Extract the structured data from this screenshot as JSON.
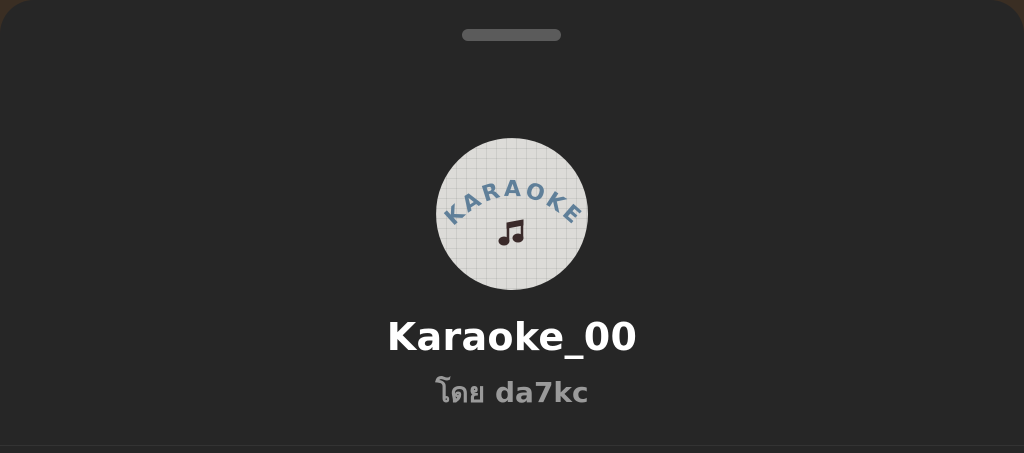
{
  "sheet": {
    "handle_icon": "drag-handle"
  },
  "thumbnail": {
    "art_text": "KARAOKE",
    "icon": "music-note-icon",
    "text_color": "#5f7f99",
    "note_color": "#3a2a2a",
    "background_color": "#dcdbd8"
  },
  "sound": {
    "title": "Karaoke_00",
    "by_label": "โดย",
    "creator": "da7kc"
  },
  "colors": {
    "sheet_background": "#262626",
    "title_text": "#ffffff",
    "secondary_text": "#9a9a9a"
  }
}
